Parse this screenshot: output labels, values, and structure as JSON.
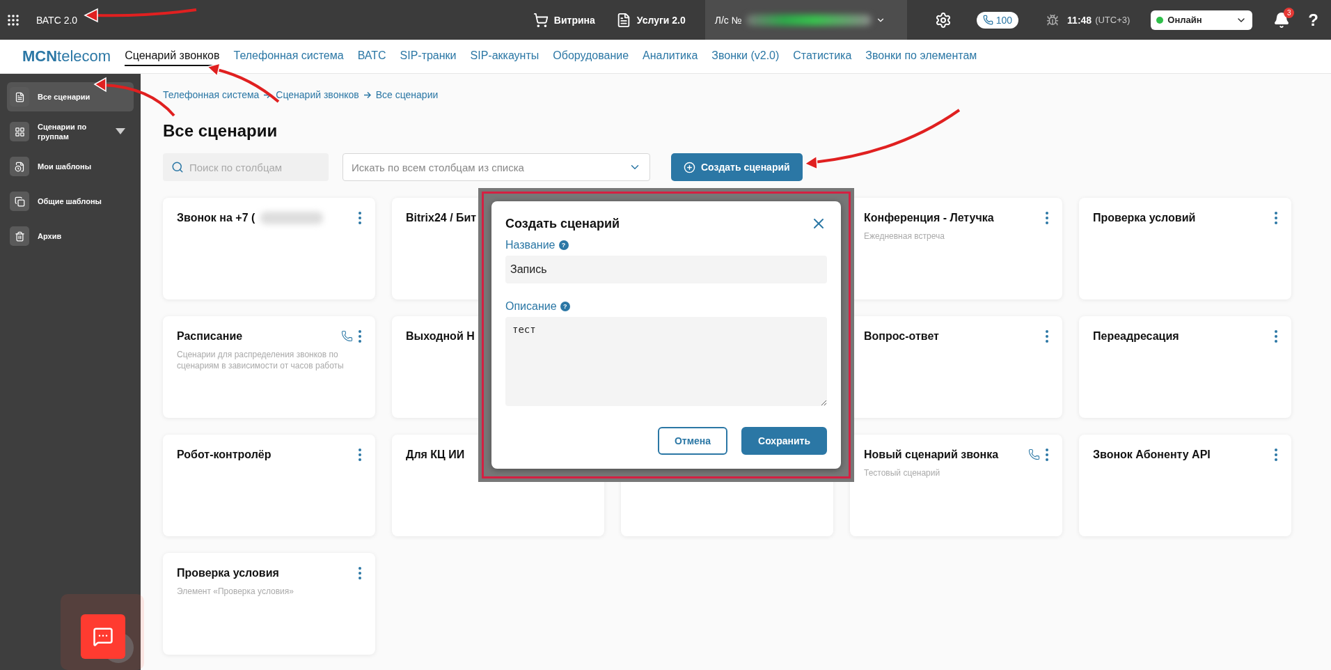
{
  "top_bar": {
    "app_title": "ВАТС 2.0",
    "shop": "Витрина",
    "services": "Услуги 2.0",
    "account_label": "Л/с №",
    "calls_count": "100",
    "time": "11:48",
    "timezone": "(UTC+3)",
    "status": {
      "label": "Онлайн",
      "color": "#2fbf4a"
    },
    "notifications": "3",
    "help": "?"
  },
  "nav": {
    "logo_bold": "MCN",
    "logo_rest": "telecom",
    "tabs": [
      {
        "label": "Сценарий звонков",
        "selected": true
      },
      {
        "label": "Телефонная система",
        "selected": false
      },
      {
        "label": "ВАТС",
        "selected": false
      },
      {
        "label": "SIP-транки",
        "selected": false
      },
      {
        "label": "SIP-аккаунты",
        "selected": false
      },
      {
        "label": "Оборудование",
        "selected": false
      },
      {
        "label": "Аналитика",
        "selected": false
      },
      {
        "label": "Звонки (v2.0)",
        "selected": false
      },
      {
        "label": "Статистика",
        "selected": false
      },
      {
        "label": "Звонки по элементам",
        "selected": false
      }
    ]
  },
  "sidebar": {
    "items": [
      {
        "label": "Все сценарии",
        "selected": true,
        "expandable": false
      },
      {
        "label": "Сценарии по группам",
        "selected": false,
        "expandable": true
      },
      {
        "label": "Мои шаблоны",
        "selected": false,
        "expandable": false
      },
      {
        "label": "Общие шаблоны",
        "selected": false,
        "expandable": false
      },
      {
        "label": "Архив",
        "selected": false,
        "expandable": false
      }
    ]
  },
  "breadcrumbs": [
    "Телефонная система",
    "Сценарий звонков",
    "Все сценарии"
  ],
  "page_title": "Все сценарии",
  "search": {
    "placeholder": "Поиск по столбцам"
  },
  "column_filter": {
    "placeholder": "Искать по всем столбцам из списка"
  },
  "create_button": "Создать сценарий",
  "cards": [
    {
      "kind": "card",
      "title": "Звонок на +7 (",
      "redacted": true,
      "phone": false
    },
    {
      "kind": "card",
      "title": "Bitrix24 / Бит",
      "phone": false
    },
    {
      "kind": "blank"
    },
    {
      "kind": "card",
      "title": "Конференция - Летучка",
      "description": "Ежедневная встреча",
      "phone": false
    },
    {
      "kind": "card",
      "title": "Проверка условий",
      "phone": false
    },
    {
      "kind": "card",
      "title": "Расписание",
      "description": "Сценарии для распределения звонков по сценариям в зависимости от часов работы",
      "phone": true
    },
    {
      "kind": "card",
      "title": "Выходной Н",
      "phone": false
    },
    {
      "kind": "blank"
    },
    {
      "kind": "card",
      "title": "Вопрос-ответ",
      "phone": false
    },
    {
      "kind": "card",
      "title": "Переадресация",
      "phone": false
    },
    {
      "kind": "card",
      "title": "Робот-контролёр",
      "phone": false
    },
    {
      "kind": "card",
      "title": "Для КЦ ИИ",
      "phone": false
    },
    {
      "kind": "card"
    },
    {
      "kind": "card",
      "title": "Новый сценарий звонка",
      "description": "Тестовый сценарий",
      "phone": true
    },
    {
      "kind": "card",
      "title": "Звонок Абоненту API",
      "phone": false
    },
    {
      "kind": "card",
      "title": "Проверка условия",
      "description": "Элемент «Проверка условия»",
      "phone": false
    }
  ],
  "dialog": {
    "title": "Создать сценарий",
    "name_label": "Название",
    "help_mark": "?",
    "name_value": "Запись",
    "description_label": "Описание",
    "description_value": "тест",
    "cancel": "Отмена",
    "save": "Сохранить"
  }
}
